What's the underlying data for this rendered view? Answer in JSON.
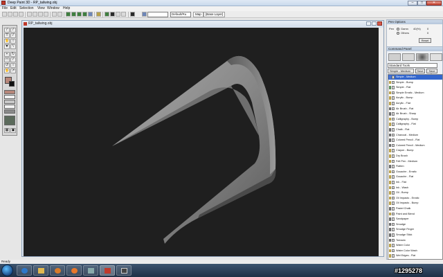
{
  "window": {
    "title": "Deep Paint 3D - RP_tailwing.obj"
  },
  "menu": [
    "File",
    "Edit",
    "Selection",
    "View",
    "Window",
    "Help"
  ],
  "toolbar": {
    "view_select": "",
    "mode_select": "Default/Ru",
    "map_button": "Map",
    "base_layer_button": "[Base Layer]"
  },
  "document": {
    "title": "RP_tailwing.obj"
  },
  "pen_options": {
    "title": "Pen Options",
    "pen_label": "Pen",
    "option_1": "Gamn",
    "option_2": "Others",
    "value_1": "40(%)",
    "value_2": "0",
    "value_3": "0",
    "reset_label": "Reset"
  },
  "command_panel": {
    "title": "Command Panel",
    "preset_select": "Standard Tools",
    "category": "Simple - Medium",
    "button_1": "Save",
    "button_2": "Save As",
    "presets": [
      {
        "label": "Simple - Medium",
        "swatch": "#4a74d1",
        "selected": true
      },
      {
        "label": "Simple - Bump",
        "swatch": "#b8a04a",
        "selected": false
      },
      {
        "label": "Simple - Flat",
        "swatch": "#5b8f5b",
        "selected": false
      },
      {
        "label": "Simple Erratic - Medium",
        "swatch": "#b8a04a",
        "selected": false
      },
      {
        "label": "Acrylic - Bump",
        "swatch": "#b8a04a",
        "selected": false
      },
      {
        "label": "Acrylic - Flat",
        "swatch": "#b8a04a",
        "selected": false
      },
      {
        "label": "Air Brush - Flat",
        "swatch": "#6a6a6a",
        "selected": false
      },
      {
        "label": "Air Brush - Sharp",
        "swatch": "#6a6a6a",
        "selected": false
      },
      {
        "label": "Calligraphy - Bump",
        "swatch": "#b8a04a",
        "selected": false
      },
      {
        "label": "Calligraphy - Flat",
        "swatch": "#b8a04a",
        "selected": false
      },
      {
        "label": "Chalk - Flat",
        "swatch": "#6a6a6a",
        "selected": false
      },
      {
        "label": "Charcoal - Medium",
        "swatch": "#6a6a6a",
        "selected": false
      },
      {
        "label": "Colored Pencil - Flat",
        "swatch": "#6a6a6a",
        "selected": false
      },
      {
        "label": "Colored Pencil - Medium",
        "swatch": "#6a6a6a",
        "selected": false
      },
      {
        "label": "Crayon - Bump",
        "swatch": "#b8a04a",
        "selected": false
      },
      {
        "label": "Dry Brush",
        "swatch": "#b8a04a",
        "selected": false
      },
      {
        "label": "Felt Pen - Medium",
        "swatch": "#b8a04a",
        "selected": false
      },
      {
        "label": "Flatten",
        "swatch": "#6a6a6a",
        "selected": false
      },
      {
        "label": "Gouache - Erratic",
        "swatch": "#b8a04a",
        "selected": false
      },
      {
        "label": "Gouache - Flat",
        "swatch": "#b8a04a",
        "selected": false
      },
      {
        "label": "Ink - Flat",
        "swatch": "#b8a04a",
        "selected": false
      },
      {
        "label": "Ink - Wash",
        "swatch": "#b8a04a",
        "selected": false
      },
      {
        "label": "Oil - Bump",
        "swatch": "#b8a04a",
        "selected": false
      },
      {
        "label": "Oil Impasto - Erratic",
        "swatch": "#b8a04a",
        "selected": false
      },
      {
        "label": "Oil Impasto - Bump",
        "swatch": "#b8a04a",
        "selected": false
      },
      {
        "label": "Pastel Chalk",
        "swatch": "#6a6a6a",
        "selected": false
      },
      {
        "label": "Paint and Blend",
        "swatch": "#b8a04a",
        "selected": false
      },
      {
        "label": "Sandpaper",
        "swatch": "#6a6a6a",
        "selected": false
      },
      {
        "label": "Smudge",
        "swatch": "#6a6a6a",
        "selected": false
      },
      {
        "label": "Smudge Finger",
        "swatch": "#6a6a6a",
        "selected": false
      },
      {
        "label": "Smudge Stick",
        "swatch": "#6a6a6a",
        "selected": false
      },
      {
        "label": "Tornado",
        "swatch": "#6a6a6a",
        "selected": false
      },
      {
        "label": "Water Color",
        "swatch": "#b8a04a",
        "selected": false
      },
      {
        "label": "Water Color Wash",
        "swatch": "#b8a04a",
        "selected": false
      },
      {
        "label": "Wet Edges - Flat",
        "swatch": "#b8a04a",
        "selected": false
      }
    ]
  },
  "status": {
    "text": "Ready"
  },
  "watermark": "#1295278"
}
